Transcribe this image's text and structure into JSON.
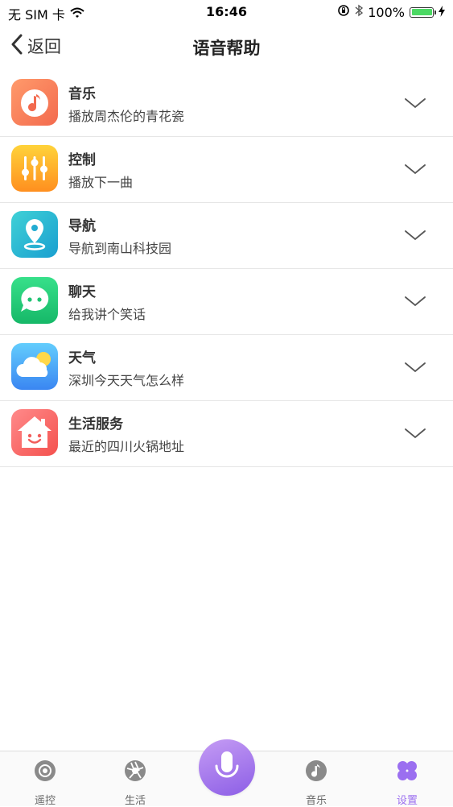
{
  "status_bar": {
    "carrier": "无 SIM 卡",
    "time": "16:46",
    "battery_percent_text": "100%",
    "battery_level": 1.0
  },
  "nav": {
    "back_label": "返回",
    "title": "语音帮助"
  },
  "items": [
    {
      "title": "音乐",
      "subtitle": "播放周杰伦的青花瓷",
      "icon": "music-note-icon",
      "colors": [
        "#ff9a6b",
        "#f36a4e"
      ]
    },
    {
      "title": "控制",
      "subtitle": "播放下一曲",
      "icon": "sliders-icon",
      "colors": [
        "#ffd33a",
        "#ff8f1f"
      ]
    },
    {
      "title": "导航",
      "subtitle": "导航到南山科技园",
      "icon": "location-pin-icon",
      "colors": [
        "#3fd1d6",
        "#1a9fd0"
      ]
    },
    {
      "title": "聊天",
      "subtitle": "给我讲个笑话",
      "icon": "chat-bubble-icon",
      "colors": [
        "#37e08a",
        "#16b868"
      ]
    },
    {
      "title": "天气",
      "subtitle": "深圳今天天气怎么样",
      "icon": "weather-cloud-icon",
      "colors": [
        "#63cdfd",
        "#3a86f2"
      ]
    },
    {
      "title": "生活服务",
      "subtitle": "最近的四川火锅地址",
      "icon": "home-smile-icon",
      "colors": [
        "#ff8a8a",
        "#f4514e"
      ]
    }
  ],
  "tabs": [
    {
      "label": "遥控",
      "icon": "remote-icon",
      "active": false
    },
    {
      "label": "生活",
      "icon": "aperture-icon",
      "active": false
    },
    {
      "label": "音乐",
      "icon": "music-disc-icon",
      "active": false
    },
    {
      "label": "设置",
      "icon": "clover-icon",
      "active": true
    }
  ],
  "colors": {
    "accent": "#9b6ff0",
    "tab_inactive": "#888888",
    "separator": "#e6e6e6"
  }
}
